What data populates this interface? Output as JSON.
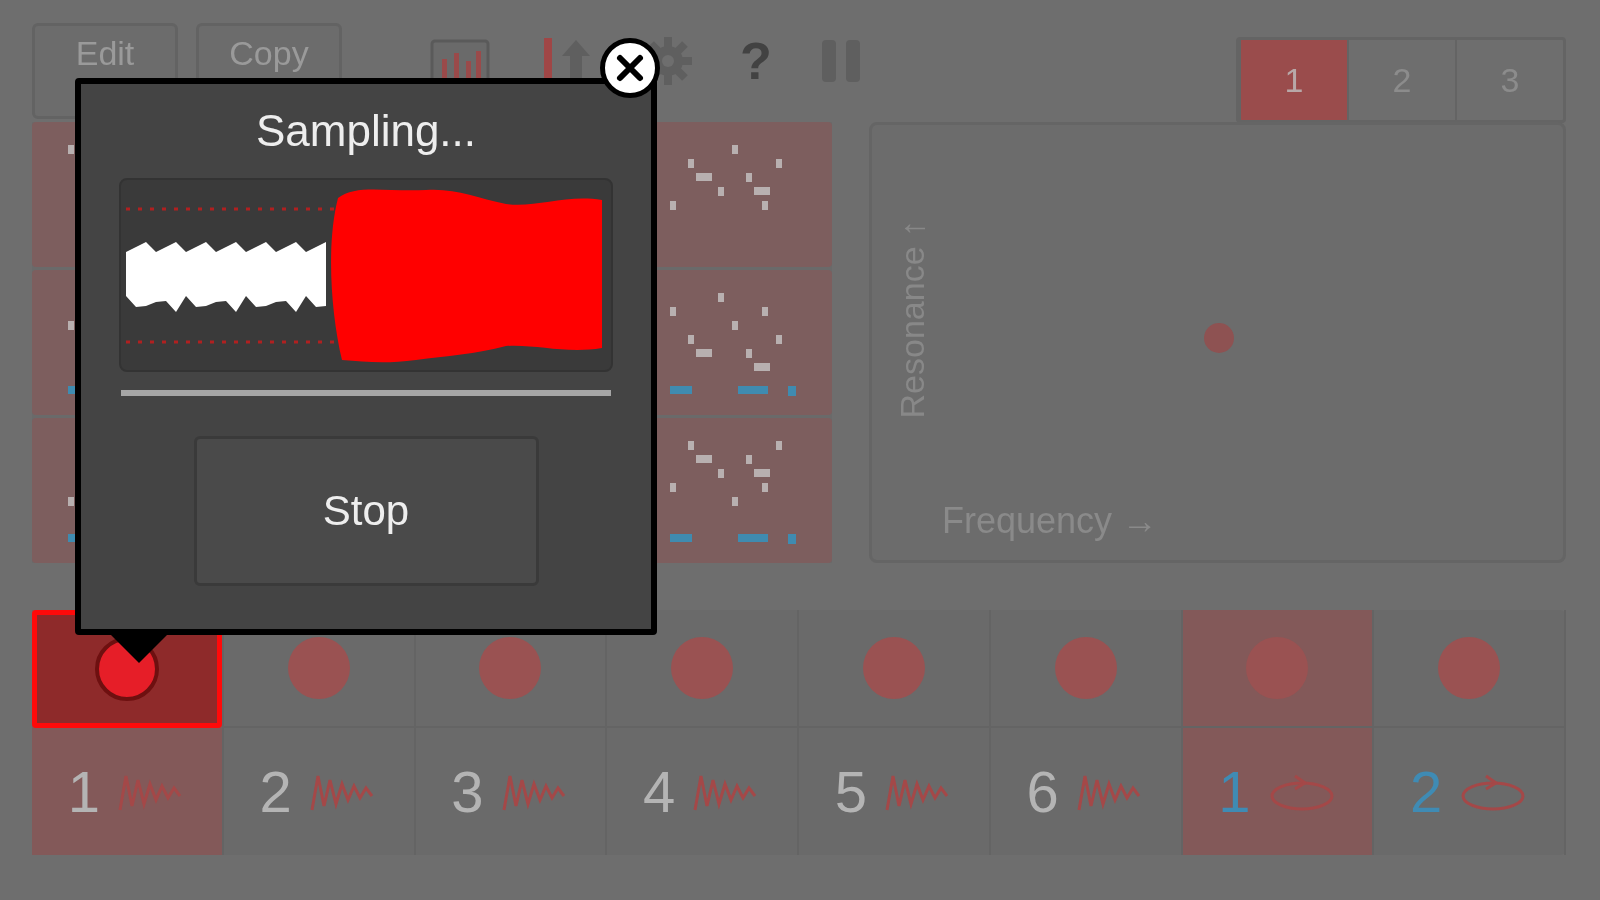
{
  "toolbar": {
    "buttons": [
      {
        "label": "Edit"
      },
      {
        "label": "Copy"
      }
    ],
    "help": "?"
  },
  "banks": [
    {
      "label": "1",
      "selected": true
    },
    {
      "label": "2",
      "selected": false
    },
    {
      "label": "3",
      "selected": false
    }
  ],
  "xy_pad": {
    "y_label": "Resonance ↑",
    "x_label": "Frequency →"
  },
  "pads": [
    {
      "number": "1",
      "kind": "sample",
      "selected": true,
      "highlighted": true
    },
    {
      "number": "2",
      "kind": "sample",
      "selected": false,
      "highlighted": false
    },
    {
      "number": "3",
      "kind": "sample",
      "selected": false,
      "highlighted": false
    },
    {
      "number": "4",
      "kind": "sample",
      "selected": false,
      "highlighted": false
    },
    {
      "number": "5",
      "kind": "sample",
      "selected": false,
      "highlighted": false
    },
    {
      "number": "6",
      "kind": "sample",
      "selected": false,
      "highlighted": false
    },
    {
      "number": "1",
      "kind": "loop",
      "selected": false,
      "highlighted": true
    },
    {
      "number": "2",
      "kind": "loop",
      "selected": false,
      "highlighted": false
    }
  ],
  "dialog": {
    "title": "Sampling...",
    "button": "Stop"
  }
}
